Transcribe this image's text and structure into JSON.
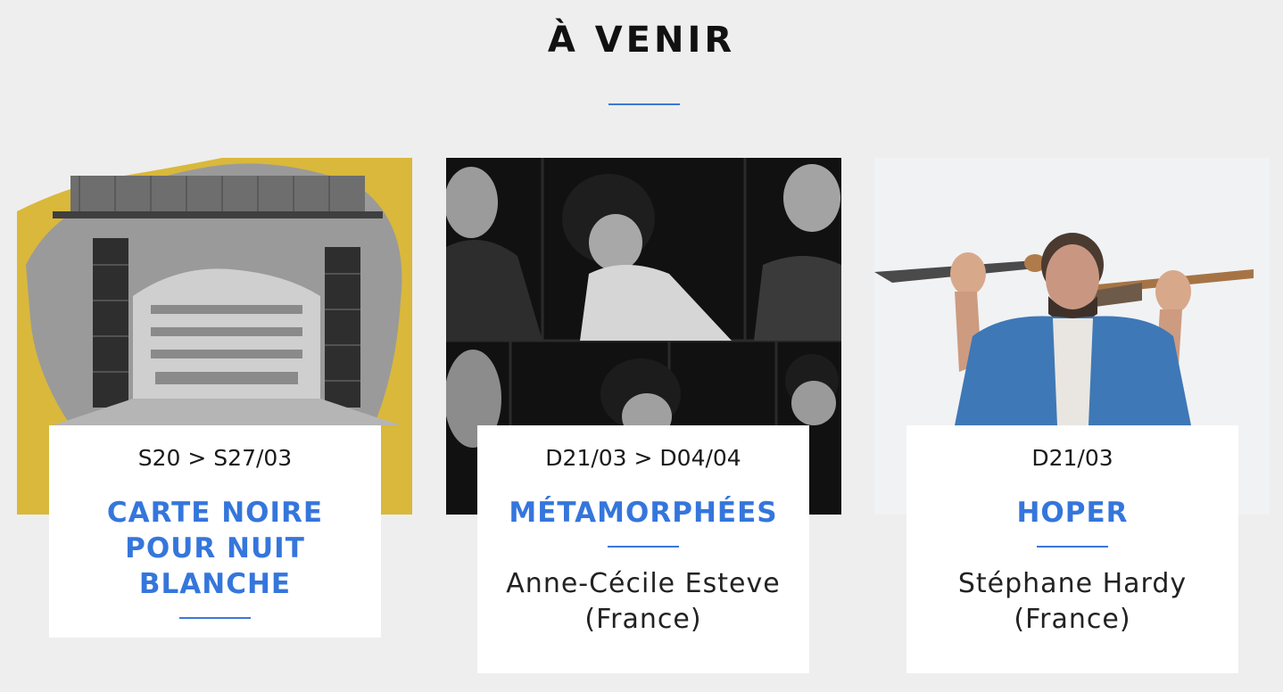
{
  "section": {
    "title": "À VENIR"
  },
  "colors": {
    "accent": "#3576dc",
    "background": "#eeeeee",
    "card": "#ffffff"
  },
  "events": [
    {
      "date": "S20 > S27/03",
      "title": "CARTE NOIRE POUR NUIT BLANCHE",
      "artist": "",
      "image": "theatre-stage-photo"
    },
    {
      "date": "D21/03 > D04/04",
      "title": "MÉTAMORPHÉES",
      "artist": "Anne-Cécile Esteve (France)",
      "image": "performers-collage-photo"
    },
    {
      "date": "D21/03",
      "title": "HOPER",
      "artist": "Stéphane Hardy (France)",
      "image": "musician-with-bagpipes-photo"
    }
  ]
}
